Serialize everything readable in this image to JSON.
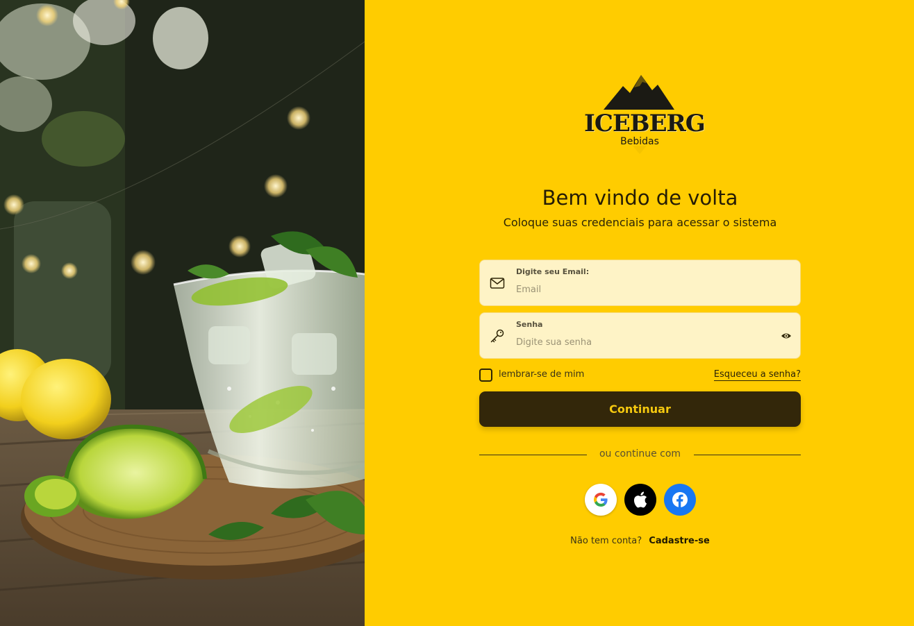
{
  "brand": {
    "logo_word": "ICEBERG",
    "logo_sub": "Bebidas",
    "accent_color": "#ffcc00",
    "button_color": "#33270a"
  },
  "login": {
    "title": "Bem vindo de volta",
    "subtitle": "Coloque suas credenciais para acessar o sistema",
    "email": {
      "label": "Digite seu Email:",
      "placeholder": "Email",
      "value": "",
      "icon": "mail-icon"
    },
    "password": {
      "label": "Senha",
      "placeholder": "Digite sua senha",
      "value": "",
      "icon": "key-icon",
      "toggle_icon": "eye-icon"
    },
    "remember_label": "lembrar-se de mim",
    "remember_checked": false,
    "forgot_label": "Esqueceu a senha?",
    "continue_label": "Continuar",
    "divider_text": "ou continue com",
    "social": [
      {
        "name": "google",
        "icon": "google-icon"
      },
      {
        "name": "apple",
        "icon": "apple-icon"
      },
      {
        "name": "facebook",
        "icon": "facebook-icon"
      }
    ],
    "signup_prompt": "Não tem conta?",
    "signup_link": "Cadastre-se"
  },
  "photo": {
    "subject": "glass of gin tonic with lime and mint"
  }
}
